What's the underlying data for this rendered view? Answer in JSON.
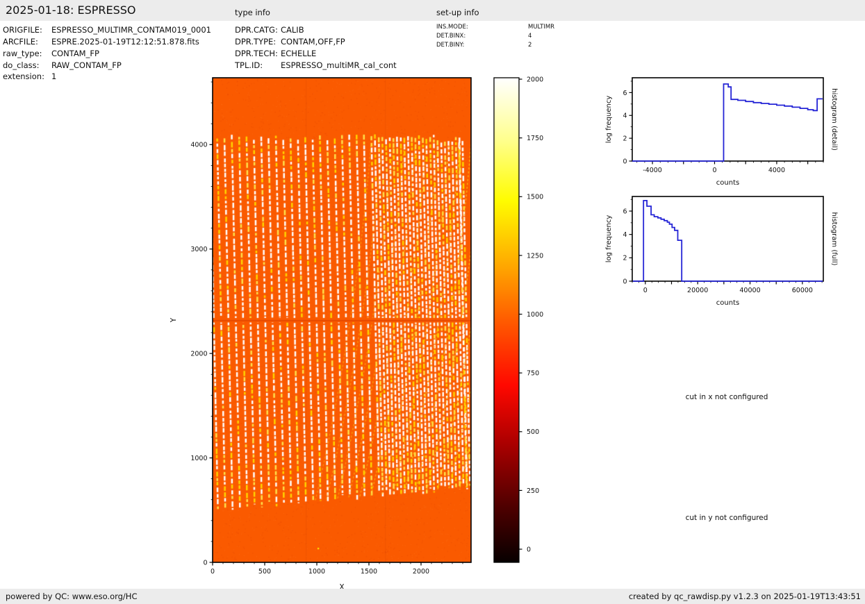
{
  "topbar": {
    "title": "2025-01-18: ESPRESSO",
    "type_info_label": "type info",
    "setup_info_label": "set-up info"
  },
  "metadata": {
    "file": [
      {
        "label": "ORIGFILE:",
        "value": "ESPRESSO_MULTIMR_CONTAM019_0001"
      },
      {
        "label": "ARCFILE:",
        "value": "ESPRE.2025-01-19T12:12:51.878.fits"
      },
      {
        "label": "raw_type:",
        "value": "CONTAM_FP"
      },
      {
        "label": "do_class:",
        "value": "RAW_CONTAM_FP"
      },
      {
        "label": "extension:",
        "value": "1"
      }
    ],
    "type": [
      {
        "label": "DPR.CATG:",
        "value": "CALIB"
      },
      {
        "label": "DPR.TYPE:",
        "value": "CONTAM,OFF,FP"
      },
      {
        "label": "DPR.TECH:",
        "value": "ECHELLE"
      },
      {
        "label": "TPL.ID:",
        "value": "ESPRESSO_multiMR_cal_cont"
      }
    ],
    "setup": [
      {
        "label": "INS.MODE:",
        "value": "MULTIMR"
      },
      {
        "label": "DET.BINX:",
        "value": "4"
      },
      {
        "label": "DET.BINY:",
        "value": "2"
      }
    ]
  },
  "messages": {
    "cut_x": "cut in x not configured",
    "cut_y": "cut in y not configured"
  },
  "footer": {
    "left": "powered by QC: www.eso.org/HC",
    "right": "created by qc_rawdisp.py v1.2.3 on 2025-01-19T13:43:51"
  },
  "colors": {
    "histogram_line": "#2424d6",
    "frame_background_orange": "#fa5a00",
    "stripe_white": "#ffffff",
    "stripe_yellow": "#ffd400",
    "bar_background": "#ececec"
  },
  "chart_data": [
    {
      "type": "heatmap",
      "panel": "raw_frame",
      "xlabel": "X",
      "ylabel": "Y",
      "xlim": [
        0,
        2480
      ],
      "ylim": [
        0,
        4640
      ],
      "xticks_major": [
        0,
        500,
        1000,
        1500,
        2000
      ],
      "xticks_labeled": [
        0,
        500,
        1000,
        1500,
        2000
      ],
      "yticks_major": [
        0,
        1000,
        2000,
        3000,
        4000
      ],
      "yticks_labeled": [
        0,
        1000,
        2000,
        3000,
        4000
      ],
      "xticks_minor_step": 100,
      "yticks_minor_step": 200,
      "background_counts": 1000,
      "stripe_region": {
        "y_min": 500,
        "y_max": 4100,
        "x_min": 30,
        "x_max": 2480,
        "approx_stripe_count": 49
      },
      "detector_gap_y": 2320,
      "colorbar": {
        "colormap": "hot",
        "vmin": -56,
        "vmax": 2006,
        "ticks": [
          0,
          250,
          500,
          750,
          1000,
          1250,
          1500,
          1750,
          2000
        ]
      }
    },
    {
      "type": "line",
      "panel": "histogram_detail",
      "side_title": "histogram (detail)",
      "xlabel": "counts",
      "ylabel": "log frequency",
      "xlim": [
        -5300,
        7000
      ],
      "ylim": [
        0,
        7.3
      ],
      "xticks_major": [
        -4000,
        -2000,
        0,
        2000,
        4000,
        6000
      ],
      "xticks_labeled": [
        -4000,
        0,
        4000
      ],
      "yticks_major": [
        0,
        2,
        4,
        6
      ],
      "yticks_labeled": [
        0,
        2,
        4,
        6
      ],
      "xticks_minor_step": 500,
      "yticks_minor_step": 1,
      "points": [
        [
          -5300,
          0
        ],
        [
          580,
          0
        ],
        [
          580,
          6.75
        ],
        [
          880,
          6.75
        ],
        [
          880,
          6.5
        ],
        [
          1060,
          6.5
        ],
        [
          1060,
          5.4
        ],
        [
          1500,
          5.4
        ],
        [
          1500,
          5.32
        ],
        [
          2000,
          5.32
        ],
        [
          2000,
          5.22
        ],
        [
          2500,
          5.22
        ],
        [
          2500,
          5.12
        ],
        [
          3000,
          5.12
        ],
        [
          3000,
          5.05
        ],
        [
          3500,
          5.05
        ],
        [
          3500,
          4.98
        ],
        [
          4000,
          4.98
        ],
        [
          4000,
          4.9
        ],
        [
          4500,
          4.9
        ],
        [
          4500,
          4.82
        ],
        [
          5000,
          4.82
        ],
        [
          5000,
          4.72
        ],
        [
          5500,
          4.72
        ],
        [
          5500,
          4.62
        ],
        [
          6000,
          4.62
        ],
        [
          6000,
          4.5
        ],
        [
          6350,
          4.5
        ],
        [
          6350,
          4.42
        ],
        [
          6600,
          4.42
        ],
        [
          6600,
          5.45
        ],
        [
          6950,
          5.45
        ]
      ]
    },
    {
      "type": "line",
      "panel": "histogram_full",
      "side_title": "histogram (full)",
      "xlabel": "counts",
      "ylabel": "log frequency",
      "xlim": [
        -5000,
        68000
      ],
      "ylim": [
        0,
        7.25
      ],
      "xticks_major": [
        0,
        10000,
        20000,
        30000,
        40000,
        50000,
        60000
      ],
      "xticks_labeled": [
        0,
        20000,
        40000,
        60000
      ],
      "yticks_major": [
        0,
        2,
        4,
        6
      ],
      "yticks_labeled": [
        0,
        2,
        4,
        6
      ],
      "xticks_minor_step": 2500,
      "yticks_minor_step": 1,
      "points": [
        [
          -4800,
          0
        ],
        [
          -700,
          0
        ],
        [
          -700,
          6.9
        ],
        [
          600,
          6.9
        ],
        [
          600,
          6.42
        ],
        [
          2200,
          6.42
        ],
        [
          2200,
          5.68
        ],
        [
          3400,
          5.68
        ],
        [
          3400,
          5.52
        ],
        [
          4800,
          5.52
        ],
        [
          4800,
          5.42
        ],
        [
          6000,
          5.42
        ],
        [
          6000,
          5.3
        ],
        [
          7200,
          5.3
        ],
        [
          7200,
          5.18
        ],
        [
          8400,
          5.18
        ],
        [
          8400,
          5.05
        ],
        [
          9200,
          5.05
        ],
        [
          9200,
          4.88
        ],
        [
          10200,
          4.88
        ],
        [
          10200,
          4.6
        ],
        [
          11200,
          4.6
        ],
        [
          11200,
          4.35
        ],
        [
          12400,
          4.35
        ],
        [
          12400,
          3.5
        ],
        [
          13900,
          3.5
        ],
        [
          13900,
          0
        ],
        [
          67800,
          0
        ]
      ]
    }
  ]
}
